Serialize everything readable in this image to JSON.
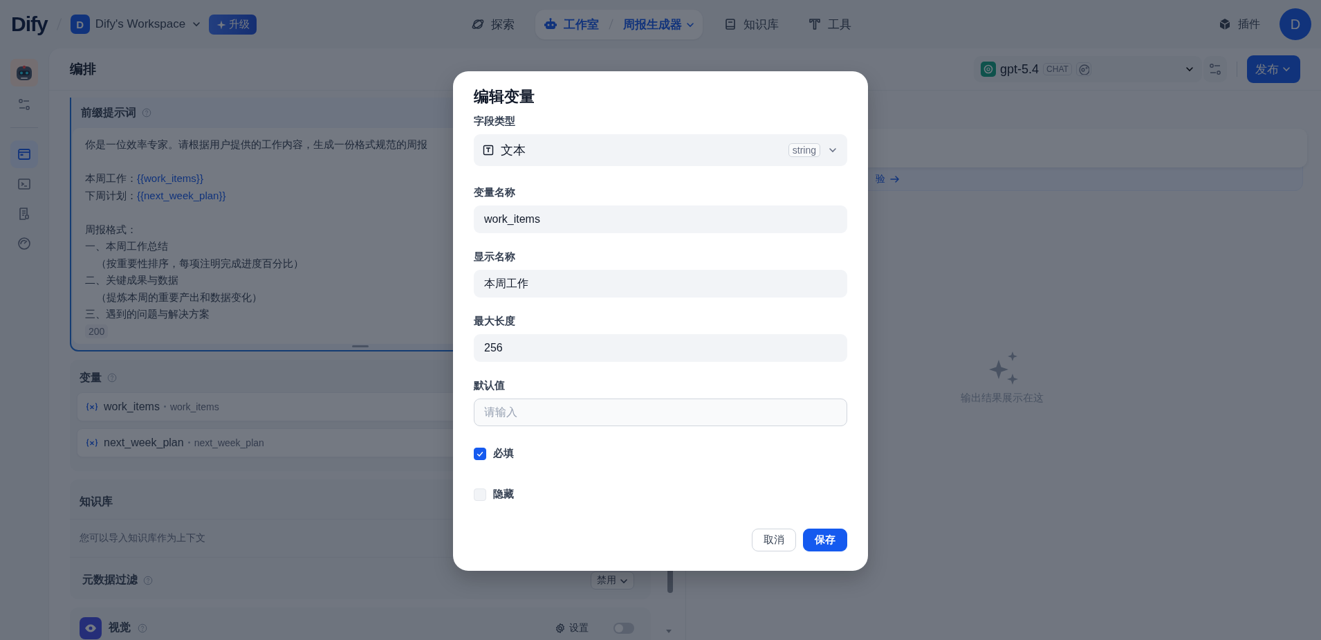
{
  "top_bar": {
    "logo": "Dify",
    "workspace": {
      "avatar": "D",
      "name": "Dify's Workspace"
    },
    "upgrade": "升级",
    "nav": [
      {
        "label": "探索",
        "selected": false
      },
      {
        "label": "工作室",
        "selected": true,
        "app": "周报生成器"
      },
      {
        "label": "知识库",
        "selected": false
      },
      {
        "label": "工具",
        "selected": false
      }
    ],
    "plugins": "插件",
    "user_avatar": "D"
  },
  "sidebar": {
    "items": [
      {
        "selected": true
      },
      {
        "selected": false
      },
      {
        "selected": false
      },
      {
        "selected": false
      }
    ]
  },
  "header": {
    "title": "编排",
    "model": {
      "name": "gpt-5.4",
      "mode": "CHAT"
    },
    "publish": "发布"
  },
  "prompt": {
    "title": "前缀提示词",
    "lines": [
      {
        "text": "你是一位效率专家。请根据用户提供的工作内容，生成一份格式规范的周报"
      },
      {
        "text": "本周工作：",
        "variable": "{{work_items}}",
        "space_before": true
      },
      {
        "text": "下周计划：",
        "variable": "{{next_week_plan}}"
      },
      {
        "text": "周报格式：",
        "space_before": true
      },
      {
        "text": "一、本周工作总结"
      },
      {
        "text": "（按重要性排序，每项注明完成进度百分比）",
        "indent": true
      },
      {
        "text": "二、关键成果与数据"
      },
      {
        "text": "（提炼本周的重要产出和数据变化）",
        "indent": true
      },
      {
        "text": "三、遇到的问题与解决方案"
      }
    ],
    "count": "200"
  },
  "variables": {
    "title": "变量",
    "items": [
      {
        "name": "work_items",
        "label": "work_items"
      },
      {
        "name": "next_week_plan",
        "label": "next_week_plan"
      }
    ]
  },
  "knowledge": {
    "title": "知识库",
    "hint": "您可以导入知识库作为上下文",
    "metadata_filter": {
      "label": "元数据过滤",
      "value": "禁用"
    }
  },
  "vision": {
    "title": "视觉",
    "settings": "设置",
    "on": false
  },
  "preview": {
    "banner_text": "验",
    "empty_text": "输出结果展示在这"
  },
  "modal": {
    "title": "编辑变量",
    "fields": [
      {
        "kind": "select",
        "label": "字段类型",
        "value": "文本",
        "tag": "string"
      },
      {
        "kind": "input",
        "label": "变量名称",
        "value": "work_items"
      },
      {
        "kind": "input",
        "label": "显示名称",
        "value": "本周工作"
      },
      {
        "kind": "input",
        "label": "最大长度",
        "value": "256"
      },
      {
        "kind": "input",
        "label": "默认值",
        "placeholder": "请输入"
      }
    ],
    "options": [
      {
        "label": "必填",
        "checked": true
      },
      {
        "label": "隐藏",
        "checked": false
      }
    ],
    "buttons": [
      {
        "label": "取消",
        "kind": "secondary"
      },
      {
        "label": "保存",
        "kind": "primary"
      }
    ]
  }
}
